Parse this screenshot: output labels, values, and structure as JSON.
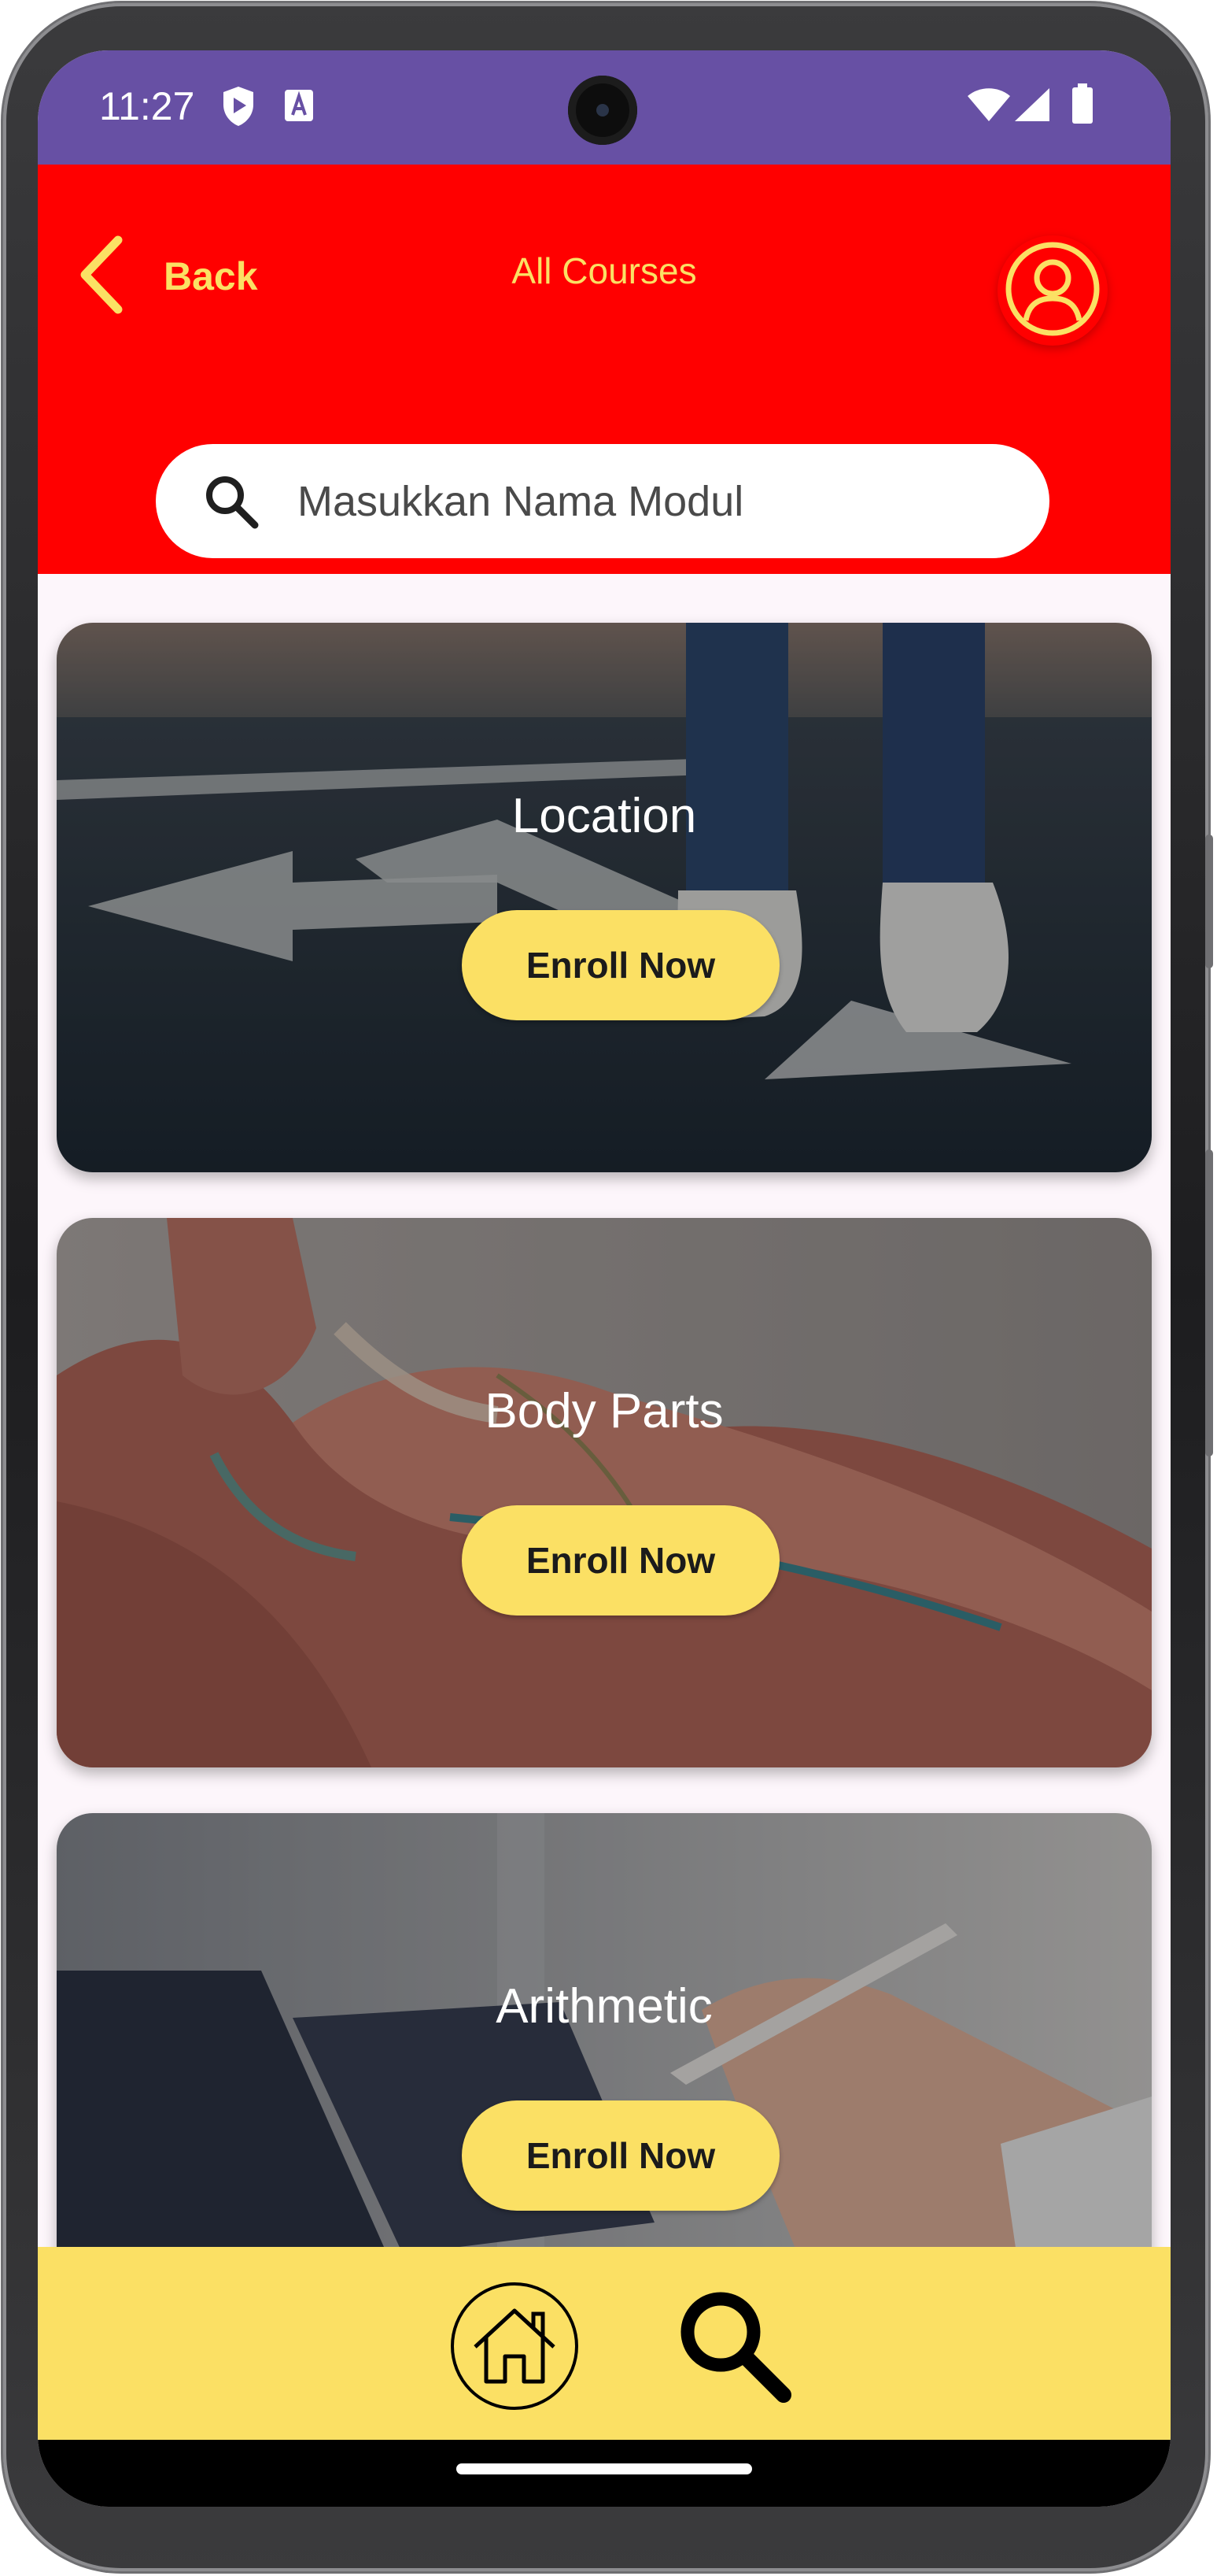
{
  "status_bar": {
    "time": "11:27",
    "icons": [
      "shield-icon",
      "keyboard-a-icon",
      "wifi-icon",
      "cell-signal-icon",
      "battery-icon"
    ],
    "color": "#6750a4"
  },
  "header": {
    "back_label": "Back",
    "title": "All Courses",
    "background_color": "#ff0000",
    "accent_color": "#fbe064"
  },
  "search": {
    "placeholder": "Masukkan Nama Modul"
  },
  "courses": [
    {
      "title": "Location",
      "button_label": "Enroll Now",
      "image": "road-arrows-walking-photo"
    },
    {
      "title": "Body Parts",
      "button_label": "Enroll Now",
      "image": "shoulder-muscle-anatomy-photo"
    },
    {
      "title": "Arithmetic",
      "button_label": "Enroll Now",
      "image": "tablet-math-formulas-photo"
    }
  ],
  "bottom_nav": {
    "items": [
      "home-icon",
      "search-icon"
    ],
    "background_color": "#fbe064"
  }
}
